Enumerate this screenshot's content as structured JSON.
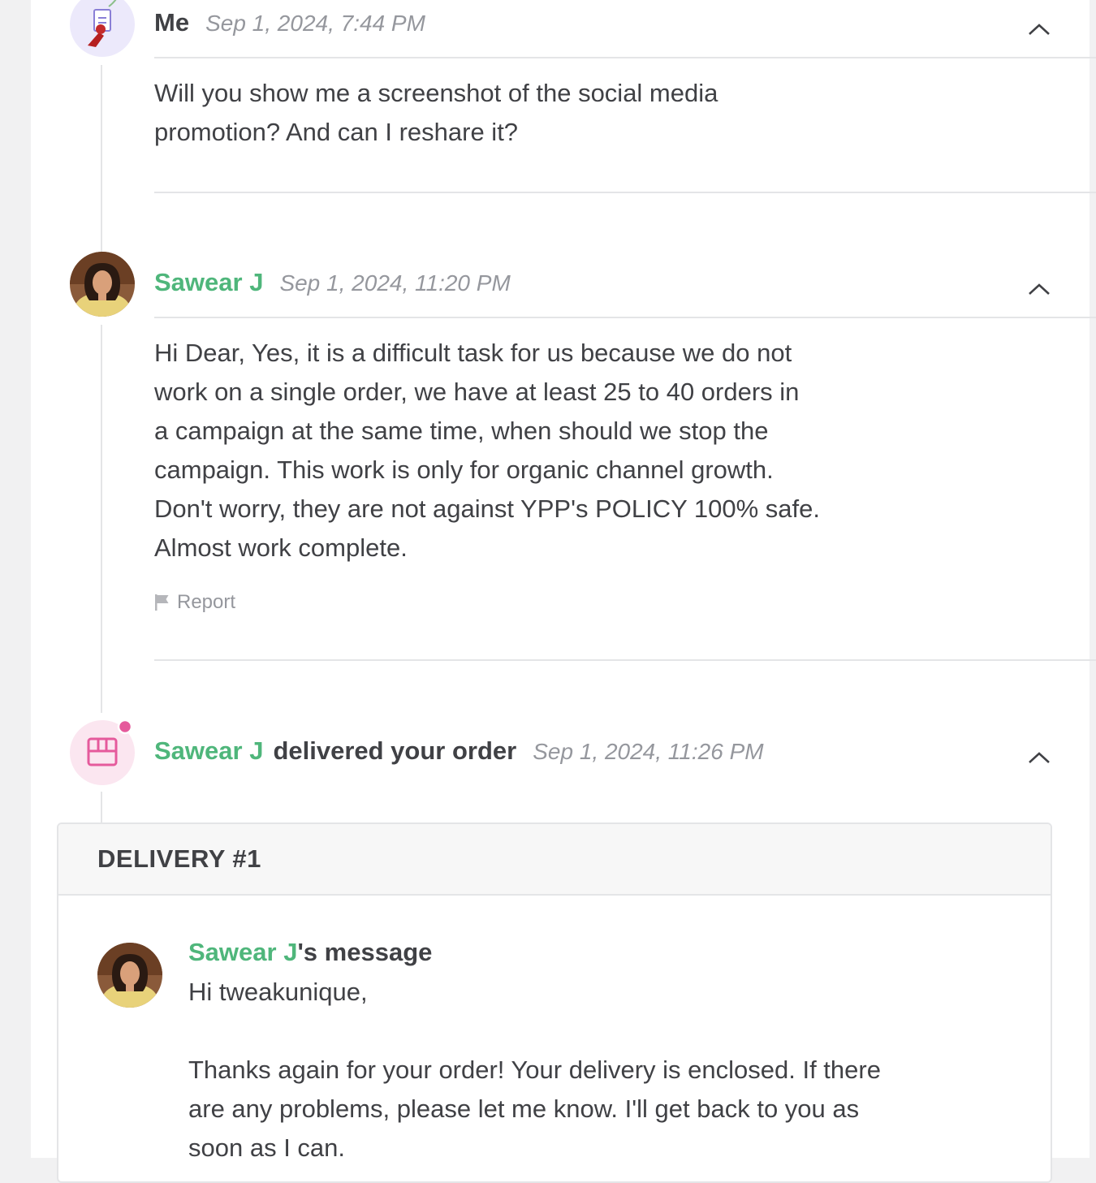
{
  "messages": [
    {
      "sender": "Me",
      "time": "Sep 1, 2024, 7:44 PM",
      "text": "Will you show me a screenshot of the social media promotion? And can I reshare it?"
    },
    {
      "sender": "Sawear J",
      "time": "Sep 1, 2024, 11:20 PM",
      "lines": [
        "Hi Dear, Yes, it is a difficult task for us because we do not",
        "work on a single order, we have at least 25 to 40 orders in",
        "a campaign at the same time, when should we stop the",
        "campaign. This work is only for organic channel growth.",
        "Don't worry, they are not against YPP's POLICY 100% safe.",
        "Almost work complete."
      ],
      "report_label": "Report"
    }
  ],
  "delivery_event": {
    "seller": "Sawear J",
    "action": "delivered your order",
    "time": "Sep 1, 2024, 11:26 PM"
  },
  "delivery_card": {
    "heading": "DELIVERY #1",
    "seller": "Sawear J",
    "suffix": "'s message",
    "greeting": "Hi tweakunique,",
    "lines": [
      "Thanks again for your order! Your delivery is enclosed. If there",
      "are any problems, please let me know. I'll get back to you as",
      "soon as I can."
    ]
  },
  "colors": {
    "seller_name": "#4fb67b",
    "text": "#404145",
    "muted": "#95979d",
    "divider": "#e4e5e7",
    "delivery_accent": "#e55a9c"
  }
}
